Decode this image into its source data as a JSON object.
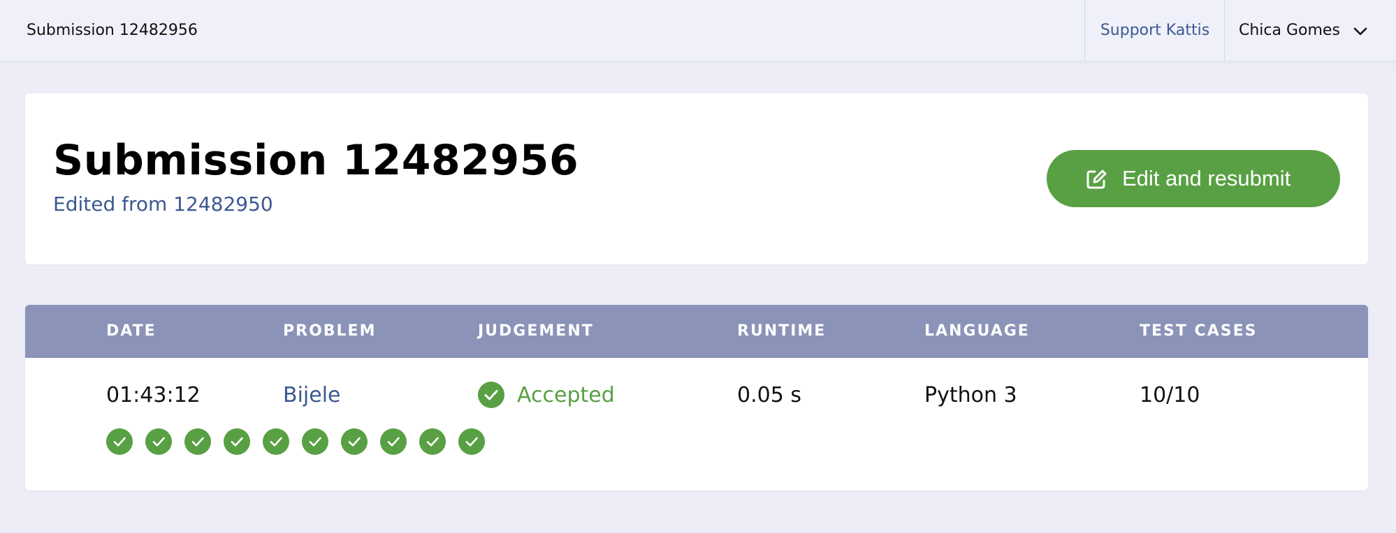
{
  "topbar": {
    "title": "Submission 12482956",
    "support_link": "Support Kattis",
    "user_name": "Chica Gomes",
    "user_menu_icon": "chevron-down-icon"
  },
  "header": {
    "title": "Submission 12482956",
    "edited_from": "Edited from 12482950",
    "resubmit_button": {
      "label": "Edit and resubmit",
      "icon": "edit-icon"
    }
  },
  "table": {
    "columns": [
      "DATE",
      "PROBLEM",
      "JUDGEMENT",
      "RUNTIME",
      "LANGUAGE",
      "TEST CASES"
    ],
    "row": {
      "date": "01:43:12",
      "problem": "Bijele",
      "judgement": "Accepted",
      "judgement_icon": "check-circle-icon",
      "runtime": "0.05 s",
      "language": "Python 3",
      "test_cases": "10/10"
    },
    "test_case_results": [
      "passed",
      "passed",
      "passed",
      "passed",
      "passed",
      "passed",
      "passed",
      "passed",
      "passed",
      "passed"
    ]
  },
  "colors": {
    "accent_green": "#58a043",
    "link_blue": "#3b5890",
    "table_header": "#8c93b8",
    "page_background": "#ecedf6"
  }
}
